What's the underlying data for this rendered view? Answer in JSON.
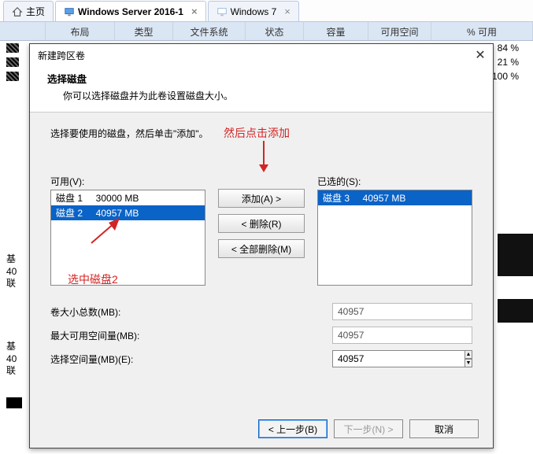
{
  "tabs": {
    "home": "主页",
    "active": "Windows Server 2016-1",
    "third": "Windows 7"
  },
  "bg_columns": [
    "",
    "布局",
    "类型",
    "文件系统",
    "状态",
    "容量",
    "可用空间",
    "% 可用"
  ],
  "bg_rows": [
    {
      "pct": "84 %"
    },
    {
      "pct": "21 %"
    },
    {
      "pct": "100 %"
    }
  ],
  "bg_left_info": [
    "基",
    "40",
    "联",
    "",
    "基",
    "40",
    "联"
  ],
  "dlg": {
    "title": "新建跨区卷",
    "section_title": "选择磁盘",
    "section_sub": "你可以选择磁盘并为此卷设置磁盘大小。",
    "hint": "选择要使用的磁盘，然后单击\"添加\"。",
    "available_label": "可用(V):",
    "selected_label": "已选的(S):",
    "available": [
      {
        "text": "磁盘 1     30000 MB",
        "selected": false
      },
      {
        "text": "磁盘 2     40957 MB",
        "selected": true
      }
    ],
    "selected": [
      {
        "text": "磁盘 3     40957 MB",
        "selected": true
      }
    ],
    "btn_add": "添加(A) >",
    "btn_remove": "< 删除(R)",
    "btn_remove_all": "< 全部删除(M)",
    "field_total": "卷大小总数(MB):",
    "val_total": "40957",
    "field_max": "最大可用空间量(MB):",
    "val_max": "40957",
    "field_sel": "选择空间量(MB)(E):",
    "val_sel": "40957",
    "btn_back": "< 上一步(B)",
    "btn_next": "下一步(N) >",
    "btn_cancel": "取消"
  },
  "annotations": {
    "top": "然后点击添加",
    "left": "选中磁盘2"
  }
}
